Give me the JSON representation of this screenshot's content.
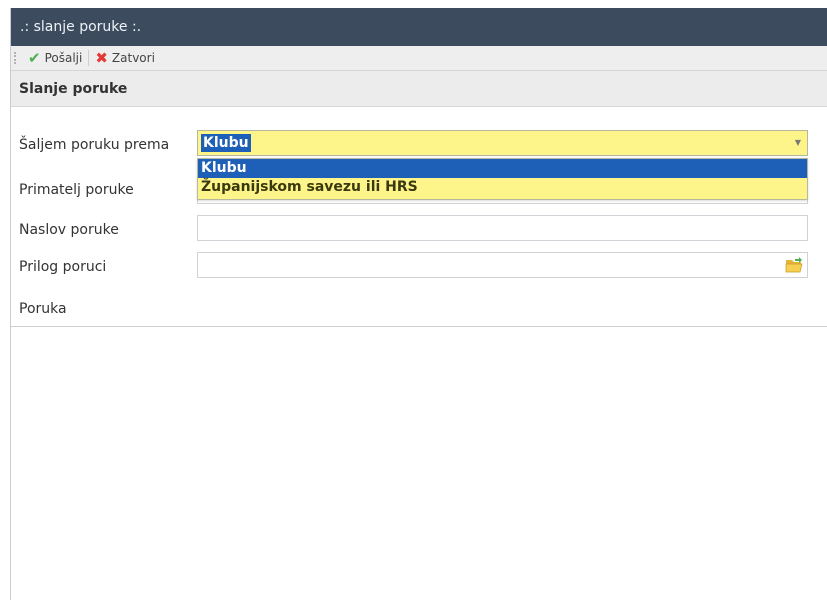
{
  "window": {
    "title": ".: slanje poruke :."
  },
  "toolbar": {
    "send_label": "Pošalji",
    "close_label": "Zatvori",
    "send_icon": "check-icon",
    "close_icon": "x-icon"
  },
  "section": {
    "title": "Slanje poruke"
  },
  "form": {
    "send_to_label": "Šaljem poruku prema",
    "send_to_value": "Klubu",
    "send_to_options": [
      "Klubu",
      "Županijskom savezu ili HRS"
    ],
    "recipient_label": "Primatelj poruke",
    "subject_label": "Naslov poruke",
    "subject_value": "",
    "attachment_label": "Prilog poruci",
    "attachment_value": "",
    "message_label": "Poruka",
    "message_value": ""
  },
  "colors": {
    "titlebar": "#3c4c5e",
    "combo_bg": "#fef58a",
    "selection": "#1e5fb8",
    "send_green": "#4caf50",
    "close_red": "#e53935"
  }
}
